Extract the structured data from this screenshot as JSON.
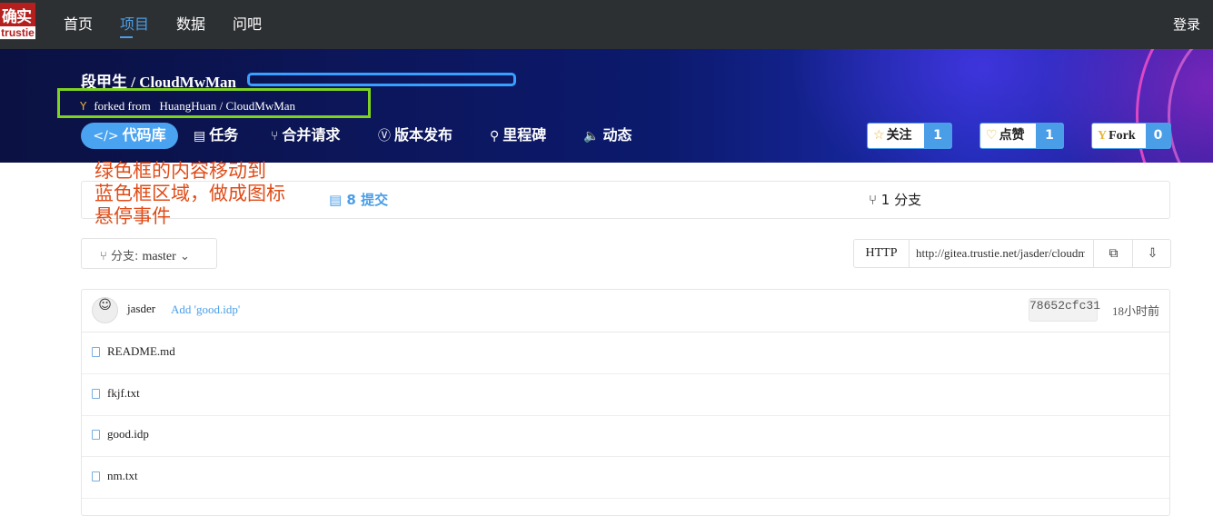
{
  "logo": {
    "glyphs": "确实",
    "word": "trustie"
  },
  "nav": {
    "items": [
      "首页",
      "项目",
      "数据",
      "问吧"
    ],
    "active_index": 1,
    "login": "登录"
  },
  "repo": {
    "owner": "段甲生",
    "separator": "/",
    "name": "CloudMwMan",
    "forked_from_label": "forked from",
    "forked_owner": "HuangHuan",
    "forked_name": "CloudMwMan"
  },
  "tabs": [
    {
      "icon": "</>",
      "label": "代码库"
    },
    {
      "icon": "▤",
      "label": "任务"
    },
    {
      "icon": "⑂",
      "label": "合并请求"
    },
    {
      "icon": "Ⓥ",
      "label": "版本发布"
    },
    {
      "icon": "⚲",
      "label": "里程碑"
    },
    {
      "icon": "🔈",
      "label": "动态"
    }
  ],
  "social": {
    "watch": {
      "label": "关注",
      "count": "1"
    },
    "like": {
      "label": "点赞",
      "count": "1"
    },
    "fork": {
      "label": "Fork",
      "count": "0"
    }
  },
  "stats": {
    "commits": "8 提交",
    "branches": "1 分支"
  },
  "annotation": [
    "绿色框的内容移动到",
    "蓝色框区域，做成图标",
    "悬停事件"
  ],
  "branch": {
    "label": "分支:",
    "value": "master"
  },
  "clone": {
    "protocol": "HTTP",
    "url": "http://gitea.trustie.net/jasder/cloudmwman.git"
  },
  "last_commit": {
    "author": "jasder",
    "message": "Add 'good.idp'",
    "sha": "78652cfc31",
    "time": "18小时前"
  },
  "files": [
    "README.md",
    "fkjf.txt",
    "good.idp",
    "nm.txt"
  ],
  "colors": {
    "topbar": "#2d3033",
    "accent": "#4a9ee8",
    "annotation": "#e04b17",
    "green_box": "#7ed321",
    "blue_box": "#3aa0ff"
  }
}
